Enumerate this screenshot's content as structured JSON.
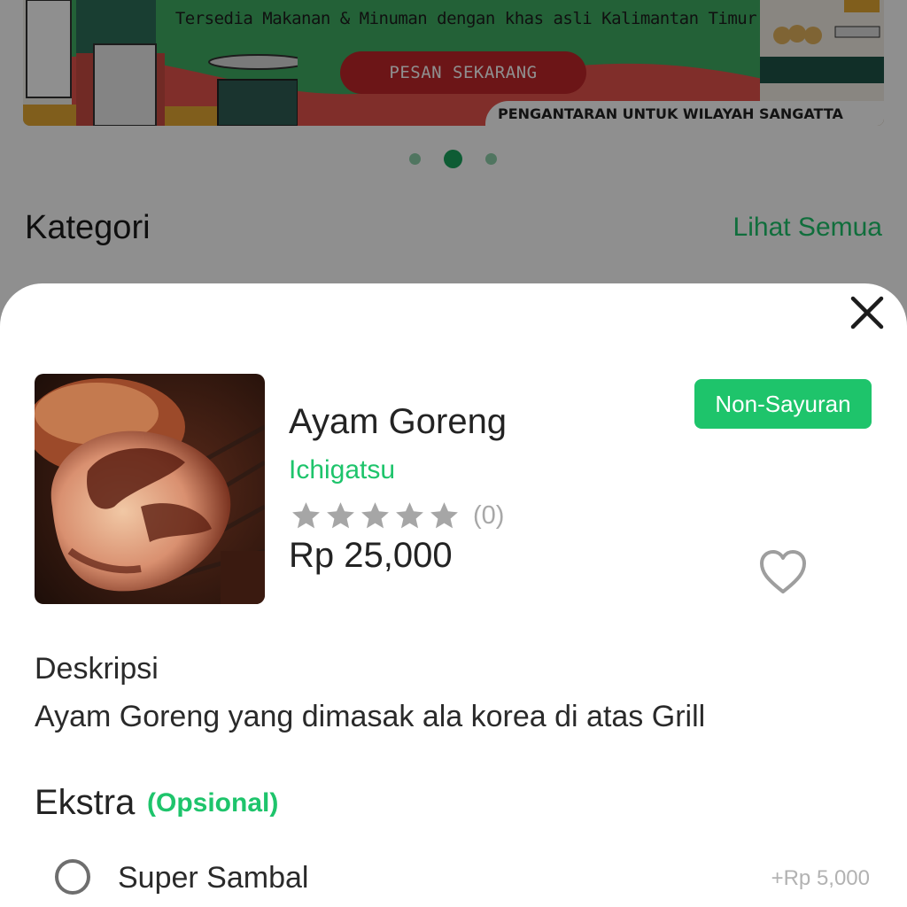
{
  "banner": {
    "headline": "Tersedia Makanan & Minuman dengan khas asli Kalimantan Timur",
    "cta_label": "PESAN SEKARANG",
    "delivery_note": "PENGANTARAN UNTUK WILAYAH SANGATTA",
    "carousel_active_index": 1,
    "carousel_count": 3
  },
  "category_section": {
    "title": "Kategori",
    "see_all_label": "Lihat Semua"
  },
  "product": {
    "name": "Ayam Goreng",
    "restaurant": "Ichigatsu",
    "rating": 0,
    "rating_count_label": "(0)",
    "price": "Rp 25,000",
    "badge": "Non-Sayuran",
    "favorited": false
  },
  "description": {
    "title": "Deskripsi",
    "text": "Ayam Goreng yang dimasak ala korea di atas Grill"
  },
  "extras": {
    "title": "Ekstra",
    "optional_label": "(Opsional)",
    "items": [
      {
        "name": "Super Sambal",
        "price": "+Rp 5,000",
        "selected": false
      }
    ]
  },
  "icons": {
    "close": "close-icon",
    "heart": "heart-icon",
    "star": "star-icon",
    "radio": "radio-unchecked-icon"
  },
  "colors": {
    "accent_green": "#1ec46b",
    "banner_red": "#c0262a",
    "star_gray": "#a6a6a6"
  }
}
